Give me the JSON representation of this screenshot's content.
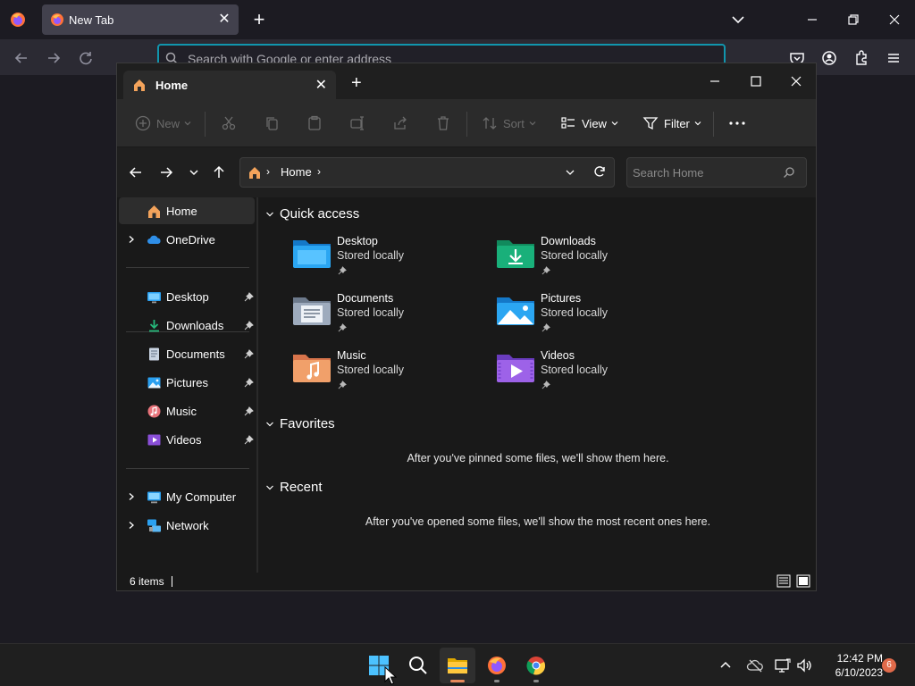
{
  "browser": {
    "tab_title": "New Tab",
    "urlbar_placeholder": "Search with Google or enter address"
  },
  "explorer": {
    "tab_title": "Home",
    "toolbar": {
      "new_label": "New",
      "sort_label": "Sort",
      "view_label": "View",
      "filter_label": "Filter"
    },
    "address": {
      "crumb": "Home",
      "search_placeholder": "Search Home"
    },
    "nav": {
      "home": "Home",
      "onedrive": "OneDrive",
      "pinned": [
        "Desktop",
        "Downloads",
        "Documents",
        "Pictures",
        "Music",
        "Videos"
      ],
      "my_computer": "My Computer",
      "network": "Network"
    },
    "sections": {
      "quick_access": "Quick access",
      "favorites": "Favorites",
      "recent": "Recent"
    },
    "quick_access": [
      {
        "name": "Desktop",
        "status": "Stored locally"
      },
      {
        "name": "Downloads",
        "status": "Stored locally"
      },
      {
        "name": "Documents",
        "status": "Stored locally"
      },
      {
        "name": "Pictures",
        "status": "Stored locally"
      },
      {
        "name": "Music",
        "status": "Stored locally"
      },
      {
        "name": "Videos",
        "status": "Stored locally"
      }
    ],
    "favorites_empty": "After you've pinned some files, we'll show them here.",
    "recent_empty": "After you've opened some files, we'll show the most recent ones here.",
    "status_count": "6 items"
  },
  "taskbar": {
    "time": "12:42 PM",
    "date": "6/10/2023",
    "notification_count": "6"
  },
  "colors": {
    "accent": "#00ddff",
    "folder_blue": "#1e90e6",
    "folder_green": "#19a974",
    "badge": "#e06a4a"
  }
}
